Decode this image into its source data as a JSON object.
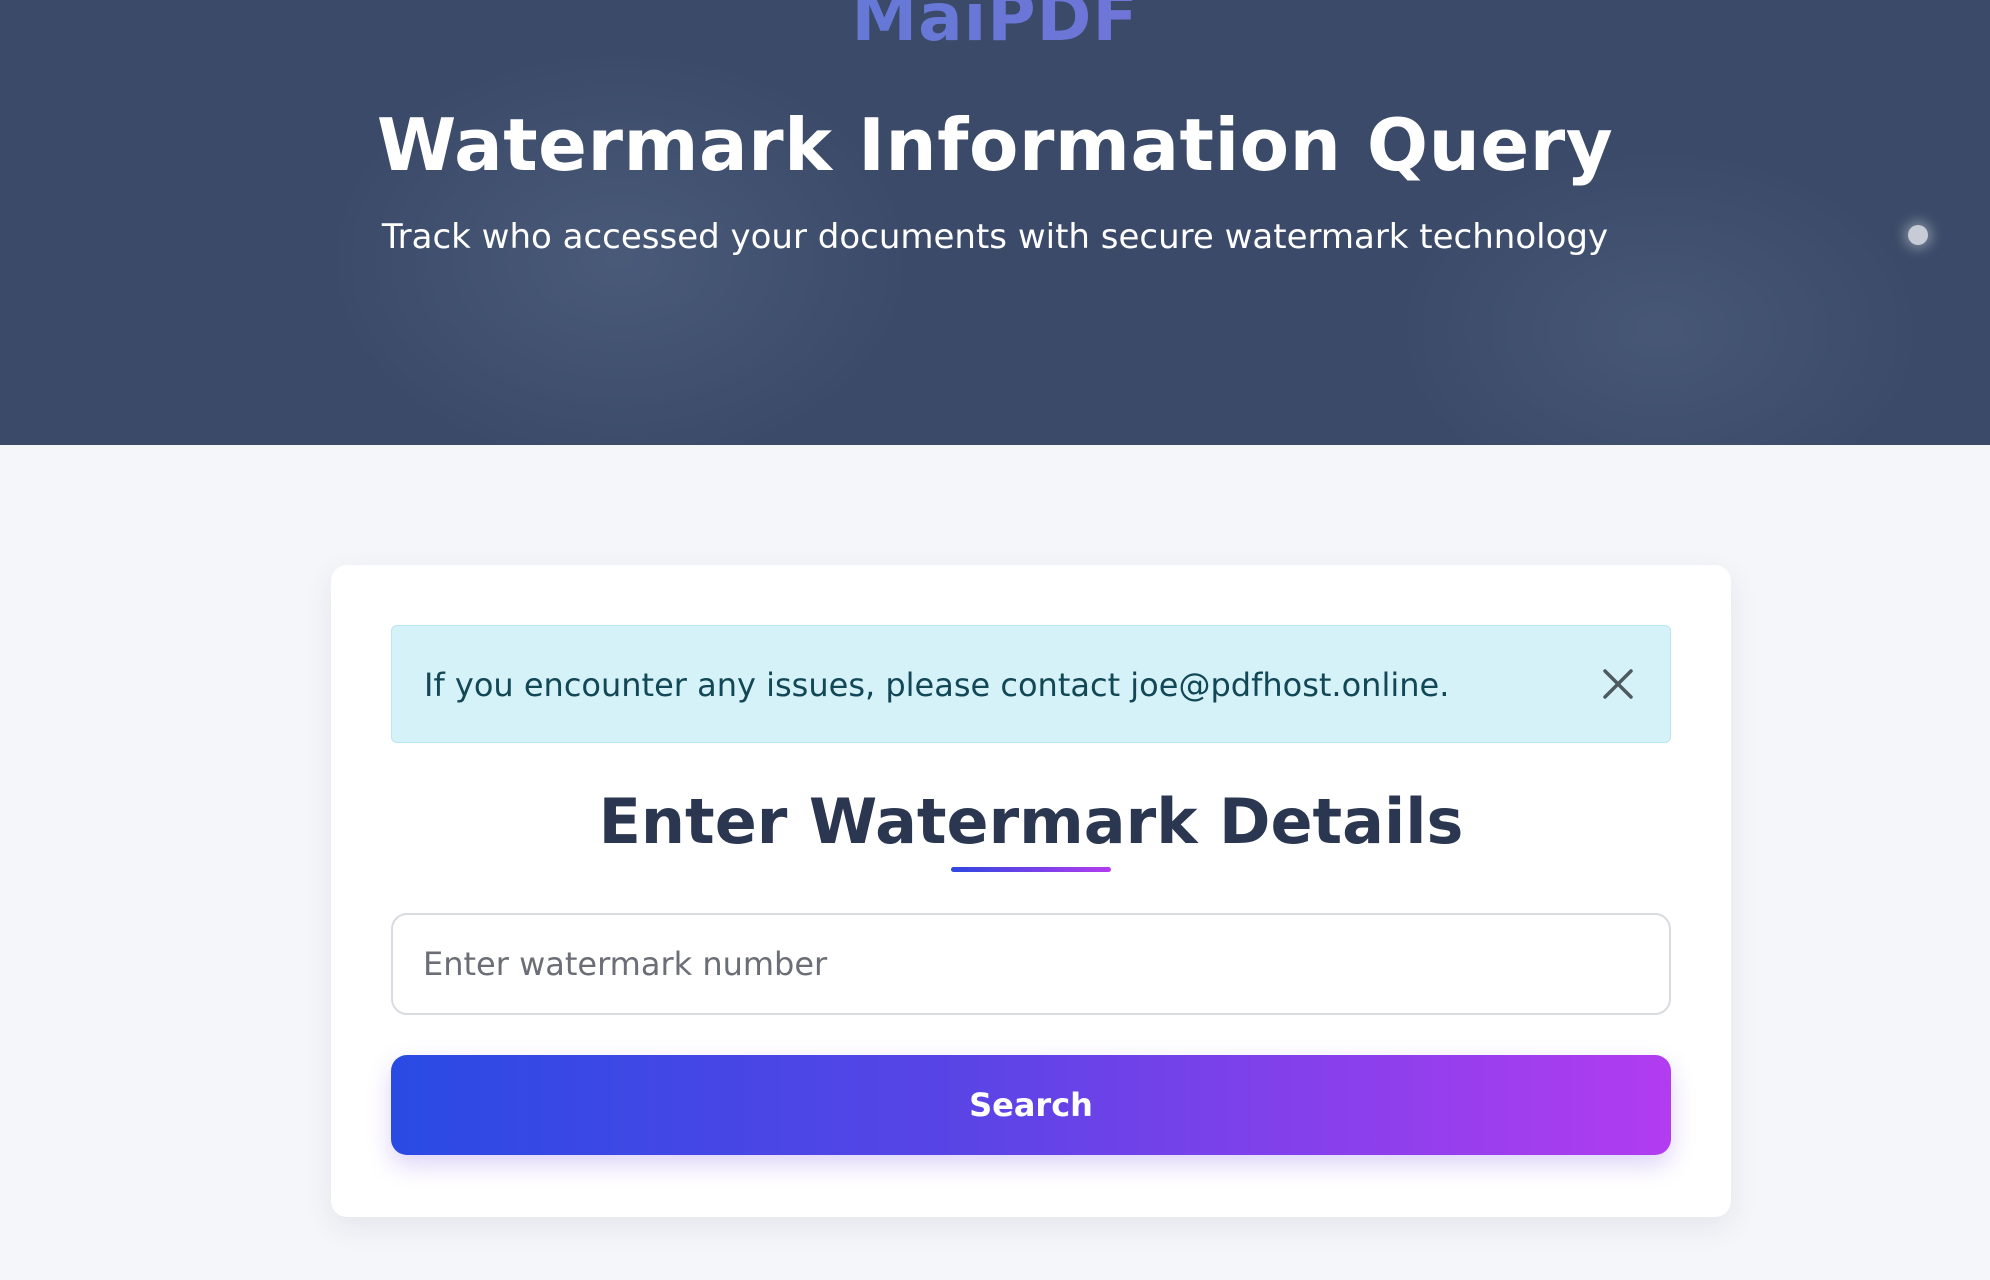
{
  "brand": {
    "logo_text": "MaiPDF"
  },
  "hero": {
    "title": "Watermark Information Query",
    "subtitle": "Track who accessed your documents with secure watermark technology"
  },
  "alert": {
    "message": "If you encounter any issues, please contact joe@pdfhost.online.",
    "close_icon": "close-icon"
  },
  "form": {
    "title": "Enter Watermark Details",
    "input_placeholder": "Enter watermark number",
    "input_value": "",
    "search_label": "Search"
  },
  "colors": {
    "hero_bg": "#3a4a68",
    "page_bg": "#f5f6fa",
    "alert_bg": "#d6f2f9",
    "alert_text": "#124756",
    "title_text": "#2b3750",
    "gradient_start": "#2a4ae4",
    "gradient_end": "#b23cf0"
  }
}
